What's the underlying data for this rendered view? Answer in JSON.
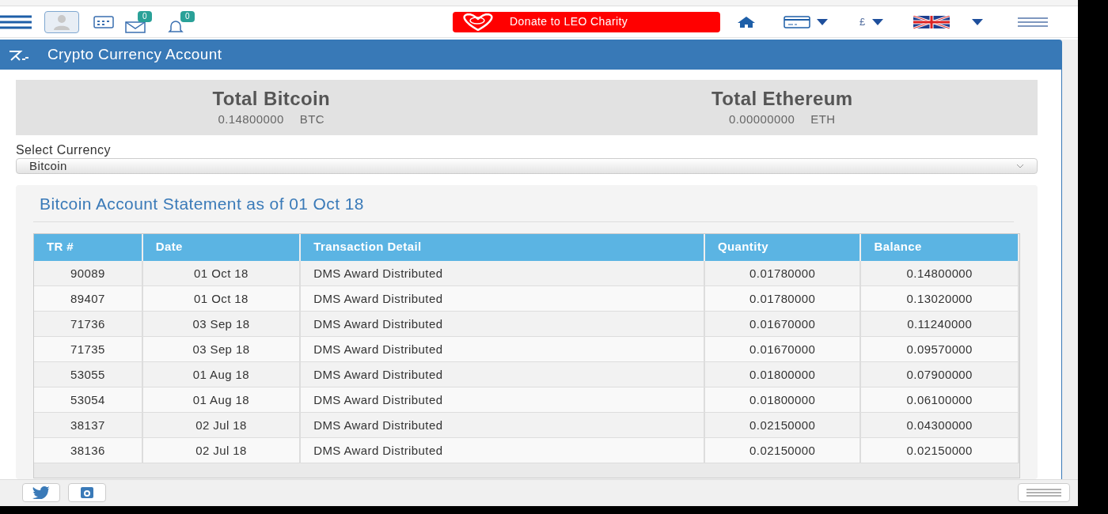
{
  "toolbar": {
    "mail_badge": "0",
    "notification_badge": "0",
    "donate_button": "Donate to LEO Charity",
    "currency": "£"
  },
  "header": {
    "title": "Crypto Currency Account"
  },
  "totals": [
    {
      "title": "Total Bitcoin",
      "amount": "0.14800000",
      "unit": "BTC"
    },
    {
      "title": "Total Ethereum",
      "amount": "0.00000000",
      "unit": "ETH"
    }
  ],
  "currency_select": {
    "label": "Select Currency",
    "value": "Bitcoin"
  },
  "statement": {
    "title": "Bitcoin Account Statement as of 01 Oct 18",
    "columns": [
      "TR #",
      "Date",
      "Transaction Detail",
      "Quantity",
      "Balance"
    ],
    "rows": [
      [
        "90089",
        "01 Oct 18",
        "DMS Award Distributed",
        "0.01780000",
        "0.14800000"
      ],
      [
        "89407",
        "01 Oct 18",
        "DMS Award Distributed",
        "0.01780000",
        "0.13020000"
      ],
      [
        "71736",
        "03 Sep 18",
        "DMS Award Distributed",
        "0.01670000",
        "0.11240000"
      ],
      [
        "71735",
        "03 Sep 18",
        "DMS Award Distributed",
        "0.01670000",
        "0.09570000"
      ],
      [
        "53055",
        "01 Aug 18",
        "DMS Award Distributed",
        "0.01800000",
        "0.07900000"
      ],
      [
        "53054",
        "01 Aug 18",
        "DMS Award Distributed",
        "0.01800000",
        "0.06100000"
      ],
      [
        "38137",
        "02 Jul 18",
        "DMS Award Distributed",
        "0.02150000",
        "0.04300000"
      ],
      [
        "38136",
        "02 Jul 18",
        "DMS Award Distributed",
        "0.02150000",
        "0.02150000"
      ]
    ]
  }
}
